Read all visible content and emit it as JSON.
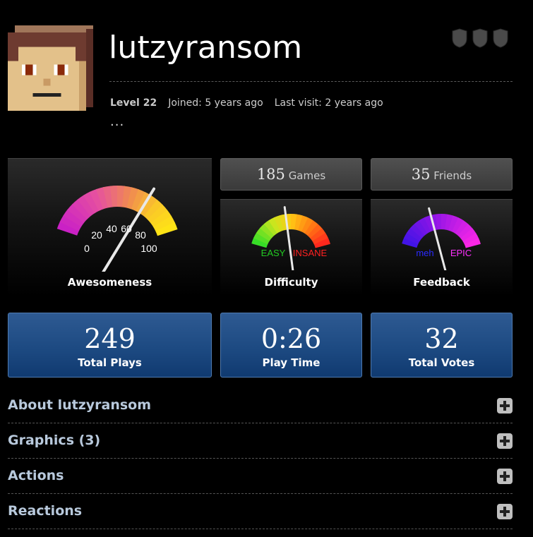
{
  "profile": {
    "username": "lutzyransom",
    "level": "Level 22",
    "joined": "Joined: 5 years ago",
    "last_visit": "Last visit: 2 years ago",
    "more": "..."
  },
  "badges": [
    "shield-icon",
    "shield-icon",
    "shield-icon"
  ],
  "counts": {
    "games_num": "185",
    "games_label": "Games",
    "friends_num": "35",
    "friends_label": "Friends"
  },
  "gauges": {
    "awesomeness": {
      "label": "Awesomeness",
      "ticks": [
        "0",
        "20",
        "40",
        "60",
        "80",
        "100"
      ],
      "value_fraction": 0.72
    },
    "difficulty": {
      "label": "Difficulty",
      "low": "EASY",
      "high": "INSANE",
      "value_fraction": 0.45
    },
    "feedback": {
      "label": "Feedback",
      "low": "meh",
      "high": "EPIC",
      "value_fraction": 0.4
    }
  },
  "stats": {
    "plays_value": "249",
    "plays_label": "Total Plays",
    "time_value": "0:26",
    "time_label": "Play Time",
    "votes_value": "32",
    "votes_label": "Total Votes"
  },
  "sections": [
    {
      "title": "About lutzyransom"
    },
    {
      "title": "Graphics (3)"
    },
    {
      "title": "Actions"
    },
    {
      "title": "Reactions"
    }
  ],
  "colors": {
    "stat_box": "#1d4a82",
    "section_title": "#b8c9dc",
    "difficulty_easy": "#22cc22",
    "difficulty_insane": "#ff2020",
    "feedback_meh": "#2b2bff",
    "feedback_epic": "#ff30ff"
  }
}
